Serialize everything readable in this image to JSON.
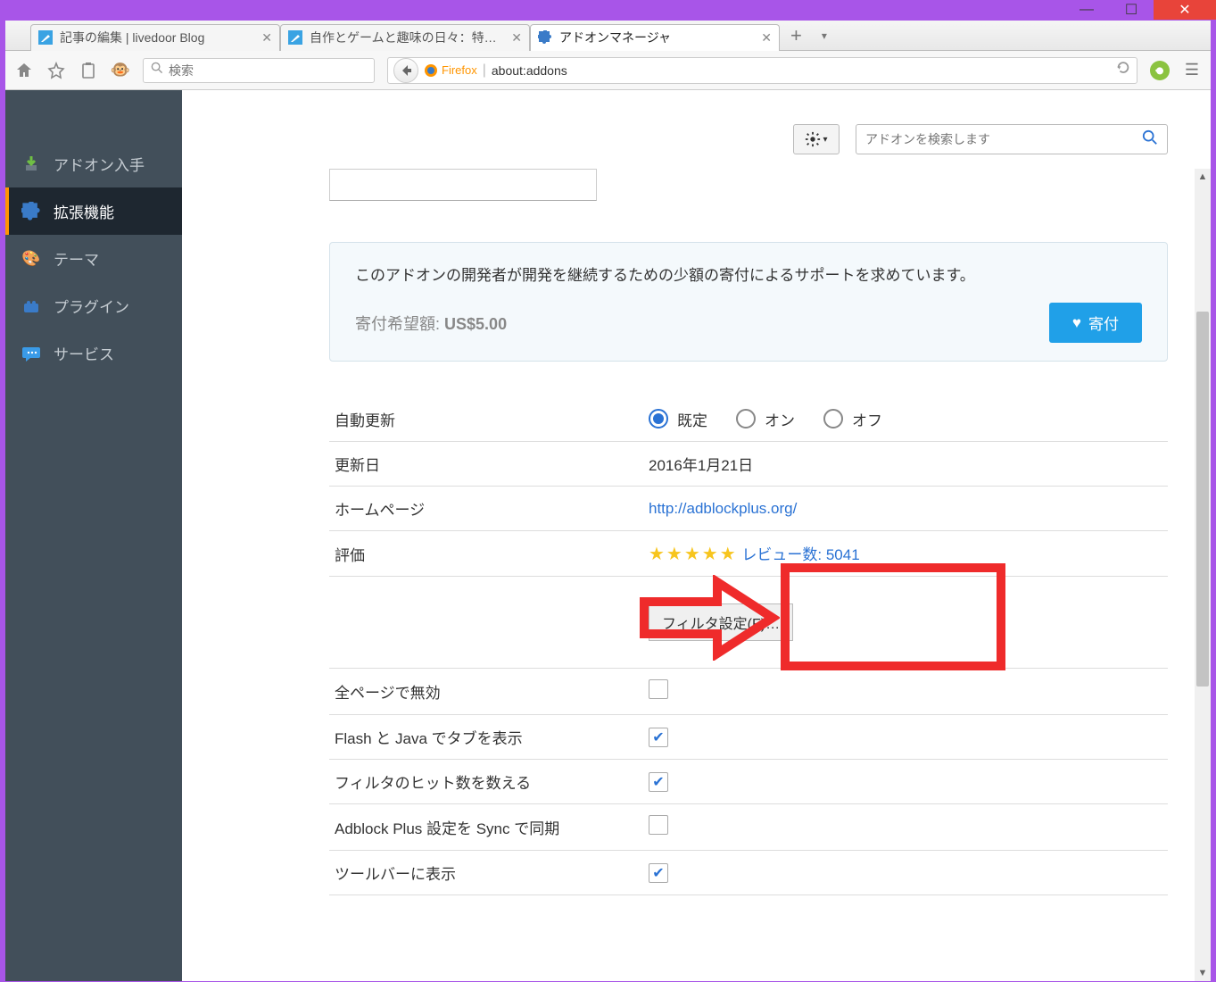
{
  "titlebar": {},
  "tabs": [
    {
      "label": "記事の編集 | livedoor Blog"
    },
    {
      "label": "自作とゲームと趣味の日々：特…"
    },
    {
      "label": "アドオンマネージャ"
    }
  ],
  "newtab": {
    "plus": "+",
    "caret": "▾"
  },
  "toolbar": {
    "search_placeholder": "検索",
    "firefox_label": "Firefox",
    "url": "about:addons"
  },
  "sidebar": {
    "items": [
      {
        "label": "アドオン入手"
      },
      {
        "label": "拡張機能"
      },
      {
        "label": "テーマ"
      },
      {
        "label": "プラグイン"
      },
      {
        "label": "サービス"
      }
    ]
  },
  "main": {
    "addon_search_placeholder": "アドオンを検索します",
    "donate": {
      "text": "このアドオンの開発者が開発を継続するための少額の寄付によるサポートを求めています。",
      "amount_label": "寄付希望額:",
      "amount_value": "US$5.00",
      "button": "寄付"
    },
    "rows": {
      "auto_update_label": "自動更新",
      "auto_update_options": [
        "既定",
        "オン",
        "オフ"
      ],
      "updated_label": "更新日",
      "updated_value": "2016年1月21日",
      "homepage_label": "ホームページ",
      "homepage_value": "http://adblockplus.org/",
      "rating_label": "評価",
      "rating_reviews": "レビュー数: 5041",
      "filter_button": "フィルタ設定(F)…",
      "disable_all_label": "全ページで無効",
      "flash_java_label": "Flash と Java でタブを表示",
      "hitcount_label": "フィルタのヒット数を数える",
      "sync_label": "Adblock Plus 設定を Sync で同期",
      "toolbar_show_label": "ツールバーに表示"
    }
  }
}
